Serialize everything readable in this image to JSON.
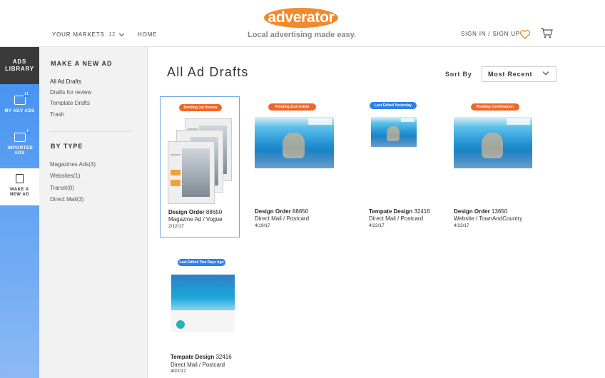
{
  "header": {
    "logo": "adverator",
    "tagline": "Local advertising made easy.",
    "markets_label": "YOUR MARKETS",
    "markets_count": "12",
    "home": "HOME",
    "signin": "SIGN IN / SIGN UP",
    "icons": [
      "heart-icon",
      "cart-icon"
    ],
    "accent_color": "#f08a2c"
  },
  "rail": {
    "library": "ADS LIBRARY",
    "items": [
      {
        "label": "MY ADV ADS",
        "badge": "11",
        "icon": "folder-icon"
      },
      {
        "label": "IMPORTED ADS",
        "badge": "2",
        "icon": "folder-icon"
      },
      {
        "label": "MAKE A NEW AD",
        "icon": "document-icon"
      }
    ]
  },
  "subnav": {
    "make_heading": "MAKE A NEW AD",
    "links": [
      "All Ad Drafts",
      "Drafts for review",
      "Template Drafts",
      "Trash"
    ],
    "type_heading": "BY TYPE",
    "types": [
      "Magazines Ads(4)",
      "Websites(1)",
      "Transit(0)",
      "Direct Mail(3)"
    ]
  },
  "main": {
    "title": "All Ad Drafts",
    "sort_label": "Sort By",
    "sort_value": "Most Recent",
    "cards": [
      {
        "status": "Pending 1st Review",
        "status_color": "#f06628",
        "title": "Design Order",
        "number": "88650",
        "sub": "Magazine Ad / Vogue",
        "date": "2/12/17",
        "selected": true
      },
      {
        "status": "Pending 2nd review",
        "status_color": "#f06628",
        "title": "Design Order",
        "number": "88650",
        "sub": "Direct Mail / Postcard",
        "date": "4/19/17"
      },
      {
        "status": "Last Edited Yesterday",
        "status_color": "#2f80ed",
        "title": "Tempate Design",
        "number": "32416",
        "sub": "Direct Mail / Postcard",
        "date": "4/22/17"
      },
      {
        "status": "Pending Confirmation",
        "status_color": "#f06628",
        "title": "Design Order",
        "number": "13650",
        "sub": "Website / TownAndCountry",
        "date": "4/23/17"
      },
      {
        "status": "Last Edited Two Days Ago",
        "status_color": "#2f80ed",
        "title": "Tempate Design",
        "number": "32416",
        "sub": "Direct Mail / Postcard",
        "date": "4/22/17"
      }
    ]
  }
}
